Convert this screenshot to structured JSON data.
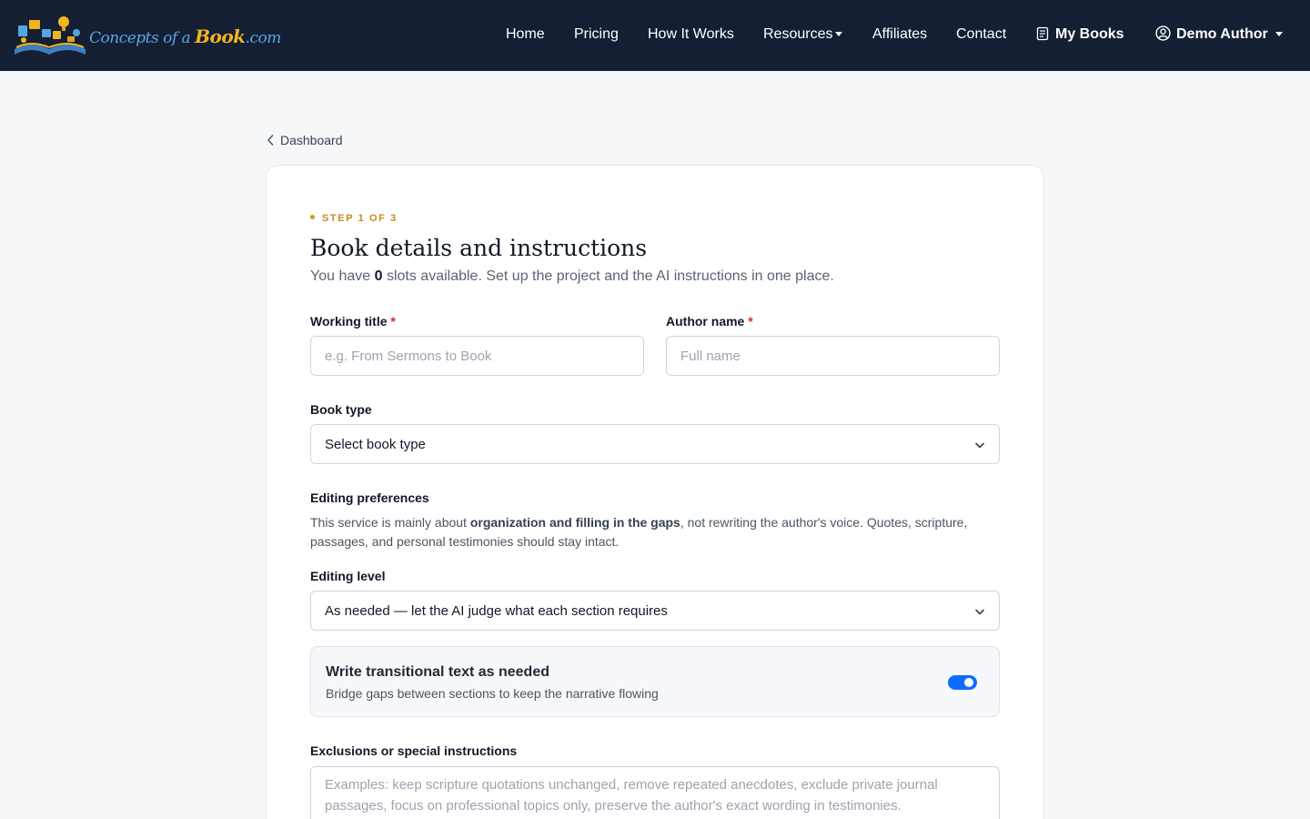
{
  "nav": {
    "logo_text_a": "Concepts of a ",
    "logo_text_b": "Book",
    "logo_text_c": ".com",
    "items": [
      {
        "label": "Home"
      },
      {
        "label": "Pricing"
      },
      {
        "label": "How It Works"
      },
      {
        "label": "Resources"
      },
      {
        "label": "Affiliates"
      },
      {
        "label": "Contact"
      }
    ],
    "my_books": "My Books",
    "user": "Demo Author"
  },
  "breadcrumb": {
    "label": "Dashboard"
  },
  "form": {
    "step": "STEP 1 OF 3",
    "title": "Book details and instructions",
    "subtitle_pre": "You have ",
    "slots": "0",
    "subtitle_post": " slots available. Set up the project and the AI instructions in one place.",
    "working_title_label": "Working title",
    "working_title_placeholder": "e.g. From Sermons to Book",
    "working_title_value": "",
    "author_label": "Author name",
    "author_placeholder": "Full name",
    "author_value": "",
    "required_mark": "*",
    "book_type_label": "Book type",
    "book_type_value": "Select book type",
    "editing_prefs_label": "Editing preferences",
    "editing_prefs_pre": "This service is mainly about ",
    "editing_prefs_bold": "organization and filling in the gaps",
    "editing_prefs_post": ", not rewriting the author's voice. Quotes, scripture, passages, and personal testimonies should stay intact.",
    "editing_level_label": "Editing level",
    "editing_level_value": "As needed — let the AI judge what each section requires",
    "transitional_title": "Write transitional text as needed",
    "transitional_sub": "Bridge gaps between sections to keep the narrative flowing",
    "transitional_on": true,
    "exclusions_label": "Exclusions or special instructions",
    "exclusions_placeholder": "Examples: keep scripture quotations unchanged, remove repeated anecdotes, exclude private journal passages, focus on professional topics only, preserve the author's exact wording in testimonies."
  },
  "colors": {
    "navbar": "#141f33",
    "accent": "#0d6efd",
    "step": "#c98a1d",
    "required": "#dc2626"
  }
}
